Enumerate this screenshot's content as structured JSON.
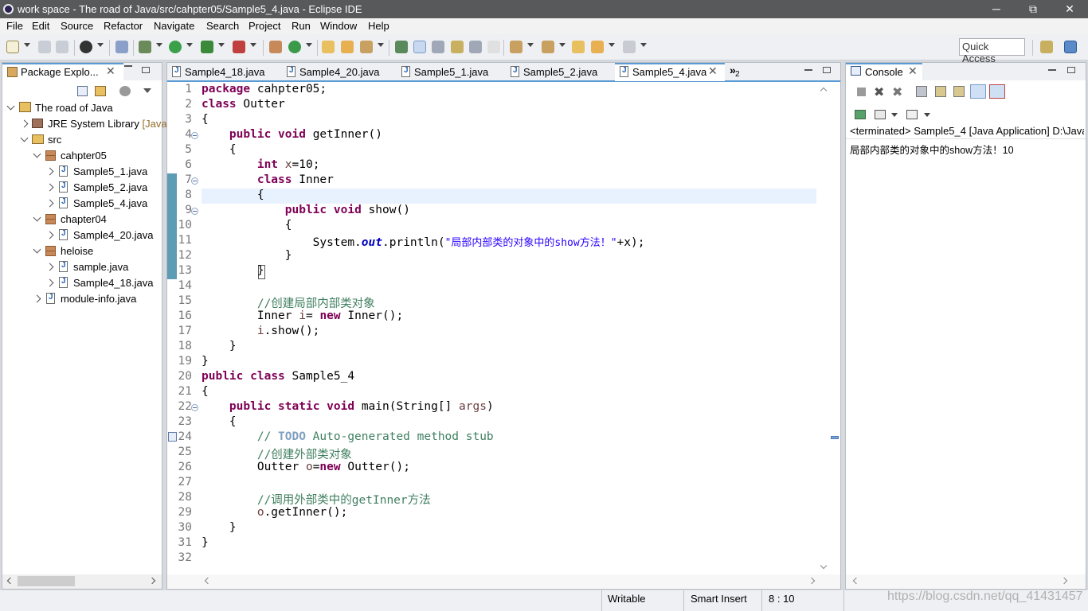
{
  "window": {
    "title": "work space - The road of Java/src/cahpter05/Sample5_4.java - Eclipse IDE",
    "minimize": "─",
    "restore": "⧉",
    "close": "✕"
  },
  "menu": [
    "File",
    "Edit",
    "Source",
    "Refactor",
    "Navigate",
    "Search",
    "Project",
    "Run",
    "Window",
    "Help"
  ],
  "quick_access": "Quick Access",
  "package_explorer": {
    "tab_label": "Package Explo...",
    "tree": [
      {
        "label": "The road of Java",
        "suffix": ""
      },
      {
        "label": "JRE System Library",
        "suffix": "[Java"
      },
      {
        "label": "src",
        "suffix": ""
      },
      {
        "label": "cahpter05",
        "suffix": ""
      },
      {
        "label": "Sample5_1.java",
        "suffix": ""
      },
      {
        "label": "Sample5_2.java",
        "suffix": ""
      },
      {
        "label": "Sample5_4.java",
        "suffix": ""
      },
      {
        "label": "chapter04",
        "suffix": ""
      },
      {
        "label": "Sample4_20.java",
        "suffix": ""
      },
      {
        "label": "heloise",
        "suffix": ""
      },
      {
        "label": "sample.java",
        "suffix": ""
      },
      {
        "label": "Sample4_18.java",
        "suffix": ""
      },
      {
        "label": "module-info.java",
        "suffix": ""
      }
    ]
  },
  "editor": {
    "tabs": [
      "Sample4_18.java",
      "Sample4_20.java",
      "Sample5_1.java",
      "Sample5_2.java",
      "Sample5_4.java"
    ],
    "active_tab": "Sample5_4.java",
    "overflow_label": "»",
    "overflow_count": "2",
    "line_numbers": [
      "1",
      "2",
      "3",
      "4",
      "5",
      "6",
      "7",
      "8",
      "9",
      "10",
      "11",
      "12",
      "13",
      "14",
      "15",
      "16",
      "17",
      "18",
      "19",
      "20",
      "21",
      "22",
      "23",
      "24",
      "25",
      "26",
      "27",
      "28",
      "29",
      "30",
      "31",
      "32"
    ],
    "code": {
      "l1_kw": "package",
      "l1_rest": " cahpter05;",
      "l2_kw": "class",
      "l2_rest": " Outter",
      "l3": "{",
      "l4_indent": "    ",
      "l4_kw1": "public",
      "l4_kw2": "void",
      "l4_rest": " getInner()",
      "l5": "    {",
      "l6_indent": "        ",
      "l6_kw": "int",
      "l6_var": " x",
      "l6_rest": "=10;",
      "l7_indent": "        ",
      "l7_kw": "class",
      "l7_rest": " Inner",
      "l8": "        {",
      "l9_indent": "            ",
      "l9_kw1": "public",
      "l9_kw2": "void",
      "l9_rest": " show()",
      "l10": "            {",
      "l11_pre": "                System.",
      "l11_field": "out",
      "l11_mid": ".println(",
      "l11_str": "\"局部内部类的对象中的show方法！\"",
      "l11_end": "+x);",
      "l12": "            }",
      "l13_indent": "        ",
      "l13_brace": "}",
      "l15": "        //创建局部内部类对象",
      "l16_pre": "        Inner",
      "l16_var": " i",
      "l16_eq": "= ",
      "l16_kw": "new",
      "l16_rest": " Inner();",
      "l17_indent": "        ",
      "l17_var": "i",
      "l17_rest": ".show();",
      "l18": "    }",
      "l19": "}",
      "l20_kw1": "public",
      "l20_kw2": "class",
      "l20_rest": " Sample5_4",
      "l21": "{",
      "l22_indent": "    ",
      "l22_kw1": "public",
      "l22_kw2": "static",
      "l22_kw3": "void",
      "l22_rest": " main(String[]",
      "l22_var": " args",
      "l22_end": ")",
      "l23": "    {",
      "l24_pre": "        // ",
      "l24_todo": "TODO",
      "l24_rest": " Auto-generated method stub",
      "l25": "        //创建外部类对象",
      "l26_pre": "        Outter",
      "l26_var": " o",
      "l26_eq": "=",
      "l26_kw": "new",
      "l26_rest": " Outter();",
      "l28": "        //调用外部类中的getInner方法",
      "l29_indent": "        ",
      "l29_var": "o",
      "l29_rest": ".getInner();",
      "l30": "    }",
      "l31": "}"
    }
  },
  "console": {
    "tab_label": "Console",
    "header": "<terminated> Sample5_4 [Java Application] D:\\Java",
    "output": "局部内部类的对象中的show方法！10"
  },
  "status": {
    "writable": "Writable",
    "insert_mode": "Smart Insert",
    "position": "8 : 10",
    "watermark": "https://blog.csdn.net/qq_41431457"
  }
}
